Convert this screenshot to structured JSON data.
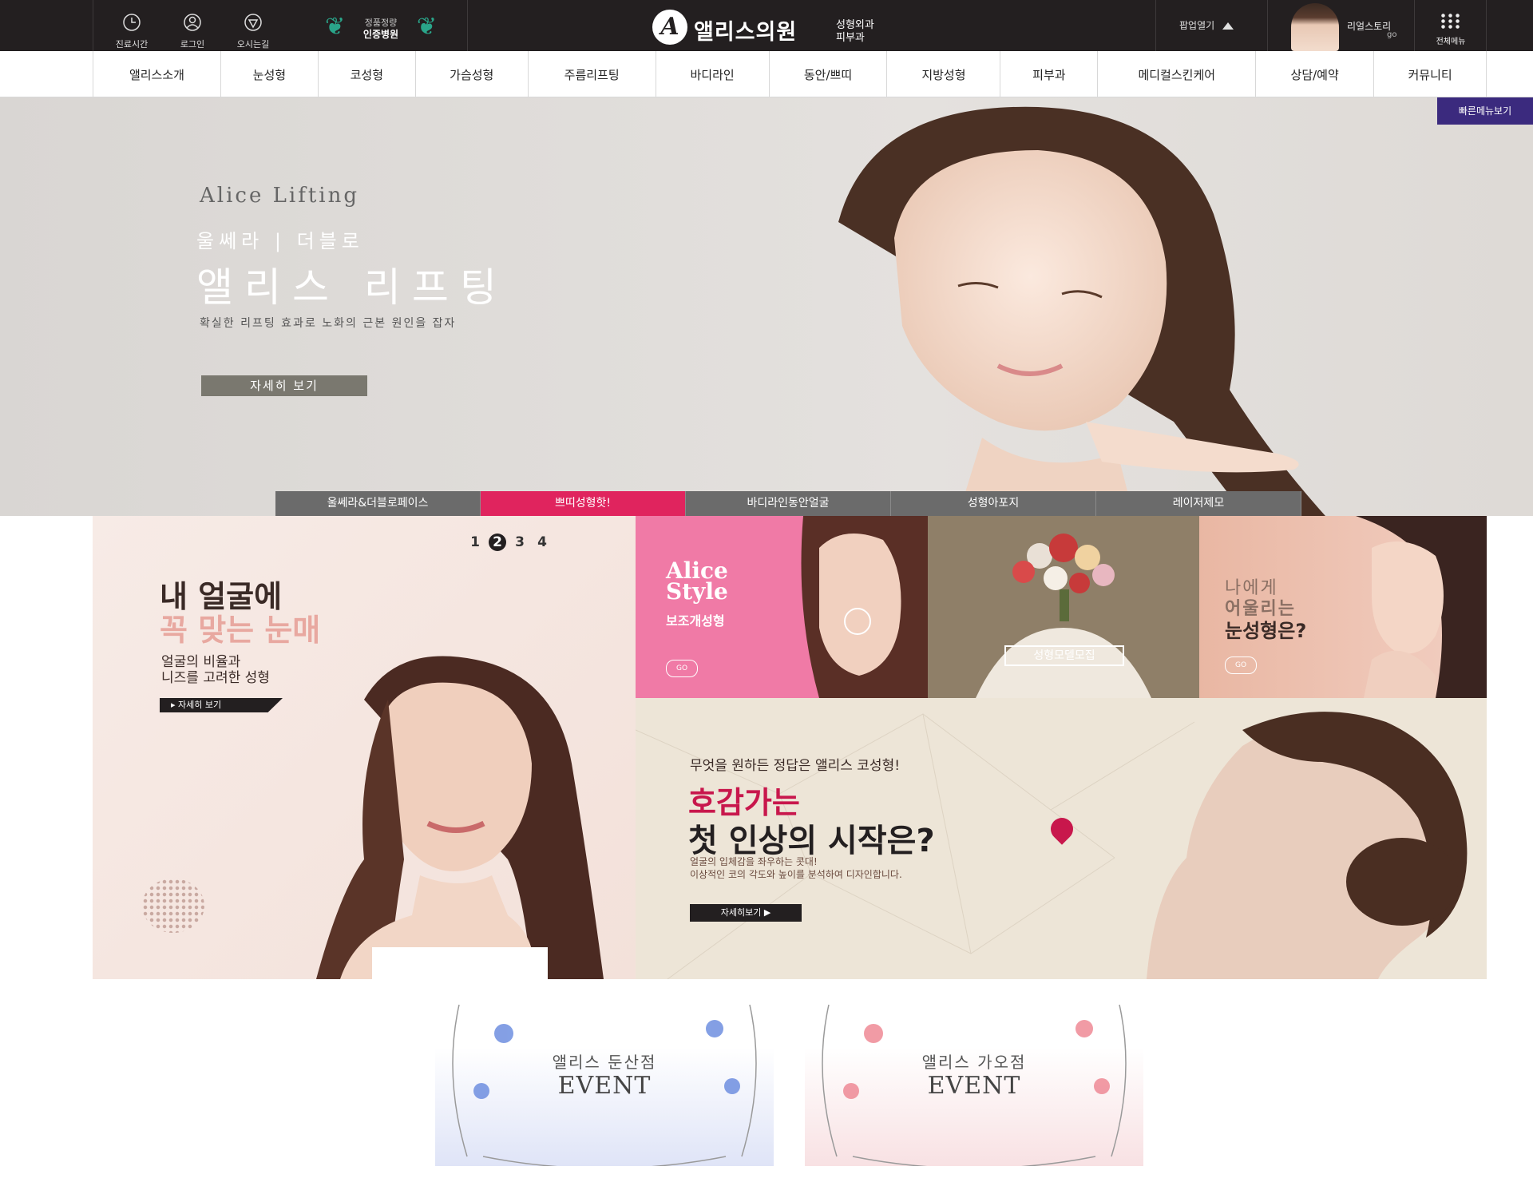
{
  "topbar": {
    "utils": [
      {
        "label": "진료시간",
        "icon": "clock-icon"
      },
      {
        "label": "로그인",
        "icon": "user-icon"
      },
      {
        "label": "오시는길",
        "icon": "map-pin-icon"
      }
    ],
    "badge": {
      "line1": "정품정량",
      "line2": "인증병원"
    },
    "logo": {
      "mark": "A",
      "name": "앨리스의원",
      "sub1": "성형외과",
      "sub2": "피부과"
    },
    "popup_label": "팝업열기",
    "story": {
      "line1": "리얼스토리",
      "line2": "go"
    },
    "allmenu_label": "전체메뉴"
  },
  "gnb": [
    "앨리스소개",
    "눈성형",
    "코성형",
    "가슴성형",
    "주름리프팅",
    "바디라인",
    "동안/쁘띠",
    "지방성형",
    "피부과",
    "메디컬스킨케어",
    "상담/예약",
    "커뮤니티"
  ],
  "quickmenu_label": "빠른메뉴보기",
  "hero": {
    "en_title": "Alice Lifting",
    "sub": "울쎄라 | 더블로",
    "title": "앨리스 리프팅",
    "desc": "확실한 리프팅 효과로 노화의 근본 원인을 잡자",
    "more_label": "자세히 보기",
    "tabs": [
      {
        "label": "울쎄라&더블로페이스",
        "active": false
      },
      {
        "label": "쁘띠성형핫!",
        "active": true
      },
      {
        "label": "바디라인동안얼굴",
        "active": false
      },
      {
        "label": "성형아포지",
        "active": false
      },
      {
        "label": "레이저제모",
        "active": false
      }
    ],
    "accent_color": "#e0245e"
  },
  "banner_eye": {
    "pager": [
      "1",
      "2",
      "3",
      "4"
    ],
    "pager_active": "2",
    "h1": "내 얼굴에",
    "h2": "꼭 맞는 눈매",
    "p1": "얼굴의 비율과",
    "p2": "니즈를 고려한 성형",
    "more_label": "▸ 자세히 보기"
  },
  "banner_style": {
    "en1": "Alice",
    "en2": "Style",
    "ko": "보조개성형",
    "go": "GO"
  },
  "banner_model": {
    "button": "성형모델모집"
  },
  "banner_suit": {
    "t1": "나에게",
    "t2": "어울리는",
    "t3": "눈성형은?",
    "go": "GO"
  },
  "banner_nose": {
    "lead": "무엇을 원하든 정답은 앨리스 코성형!",
    "h1": "호감가는",
    "h2": "첫 인상의 시작은?",
    "p1": "얼굴의 입체감을 좌우하는 콧대!",
    "p2": "이상적인 코의 각도와 높이를 분석하여 디자인합니다.",
    "more_label": "자세히보기 ▶"
  },
  "events": [
    {
      "name": "앨리스 둔산점",
      "label": "EVENT",
      "flower_color": "#6f8fe0"
    },
    {
      "name": "앨리스 가오점",
      "label": "EVENT",
      "flower_color": "#ef8a96"
    }
  ]
}
